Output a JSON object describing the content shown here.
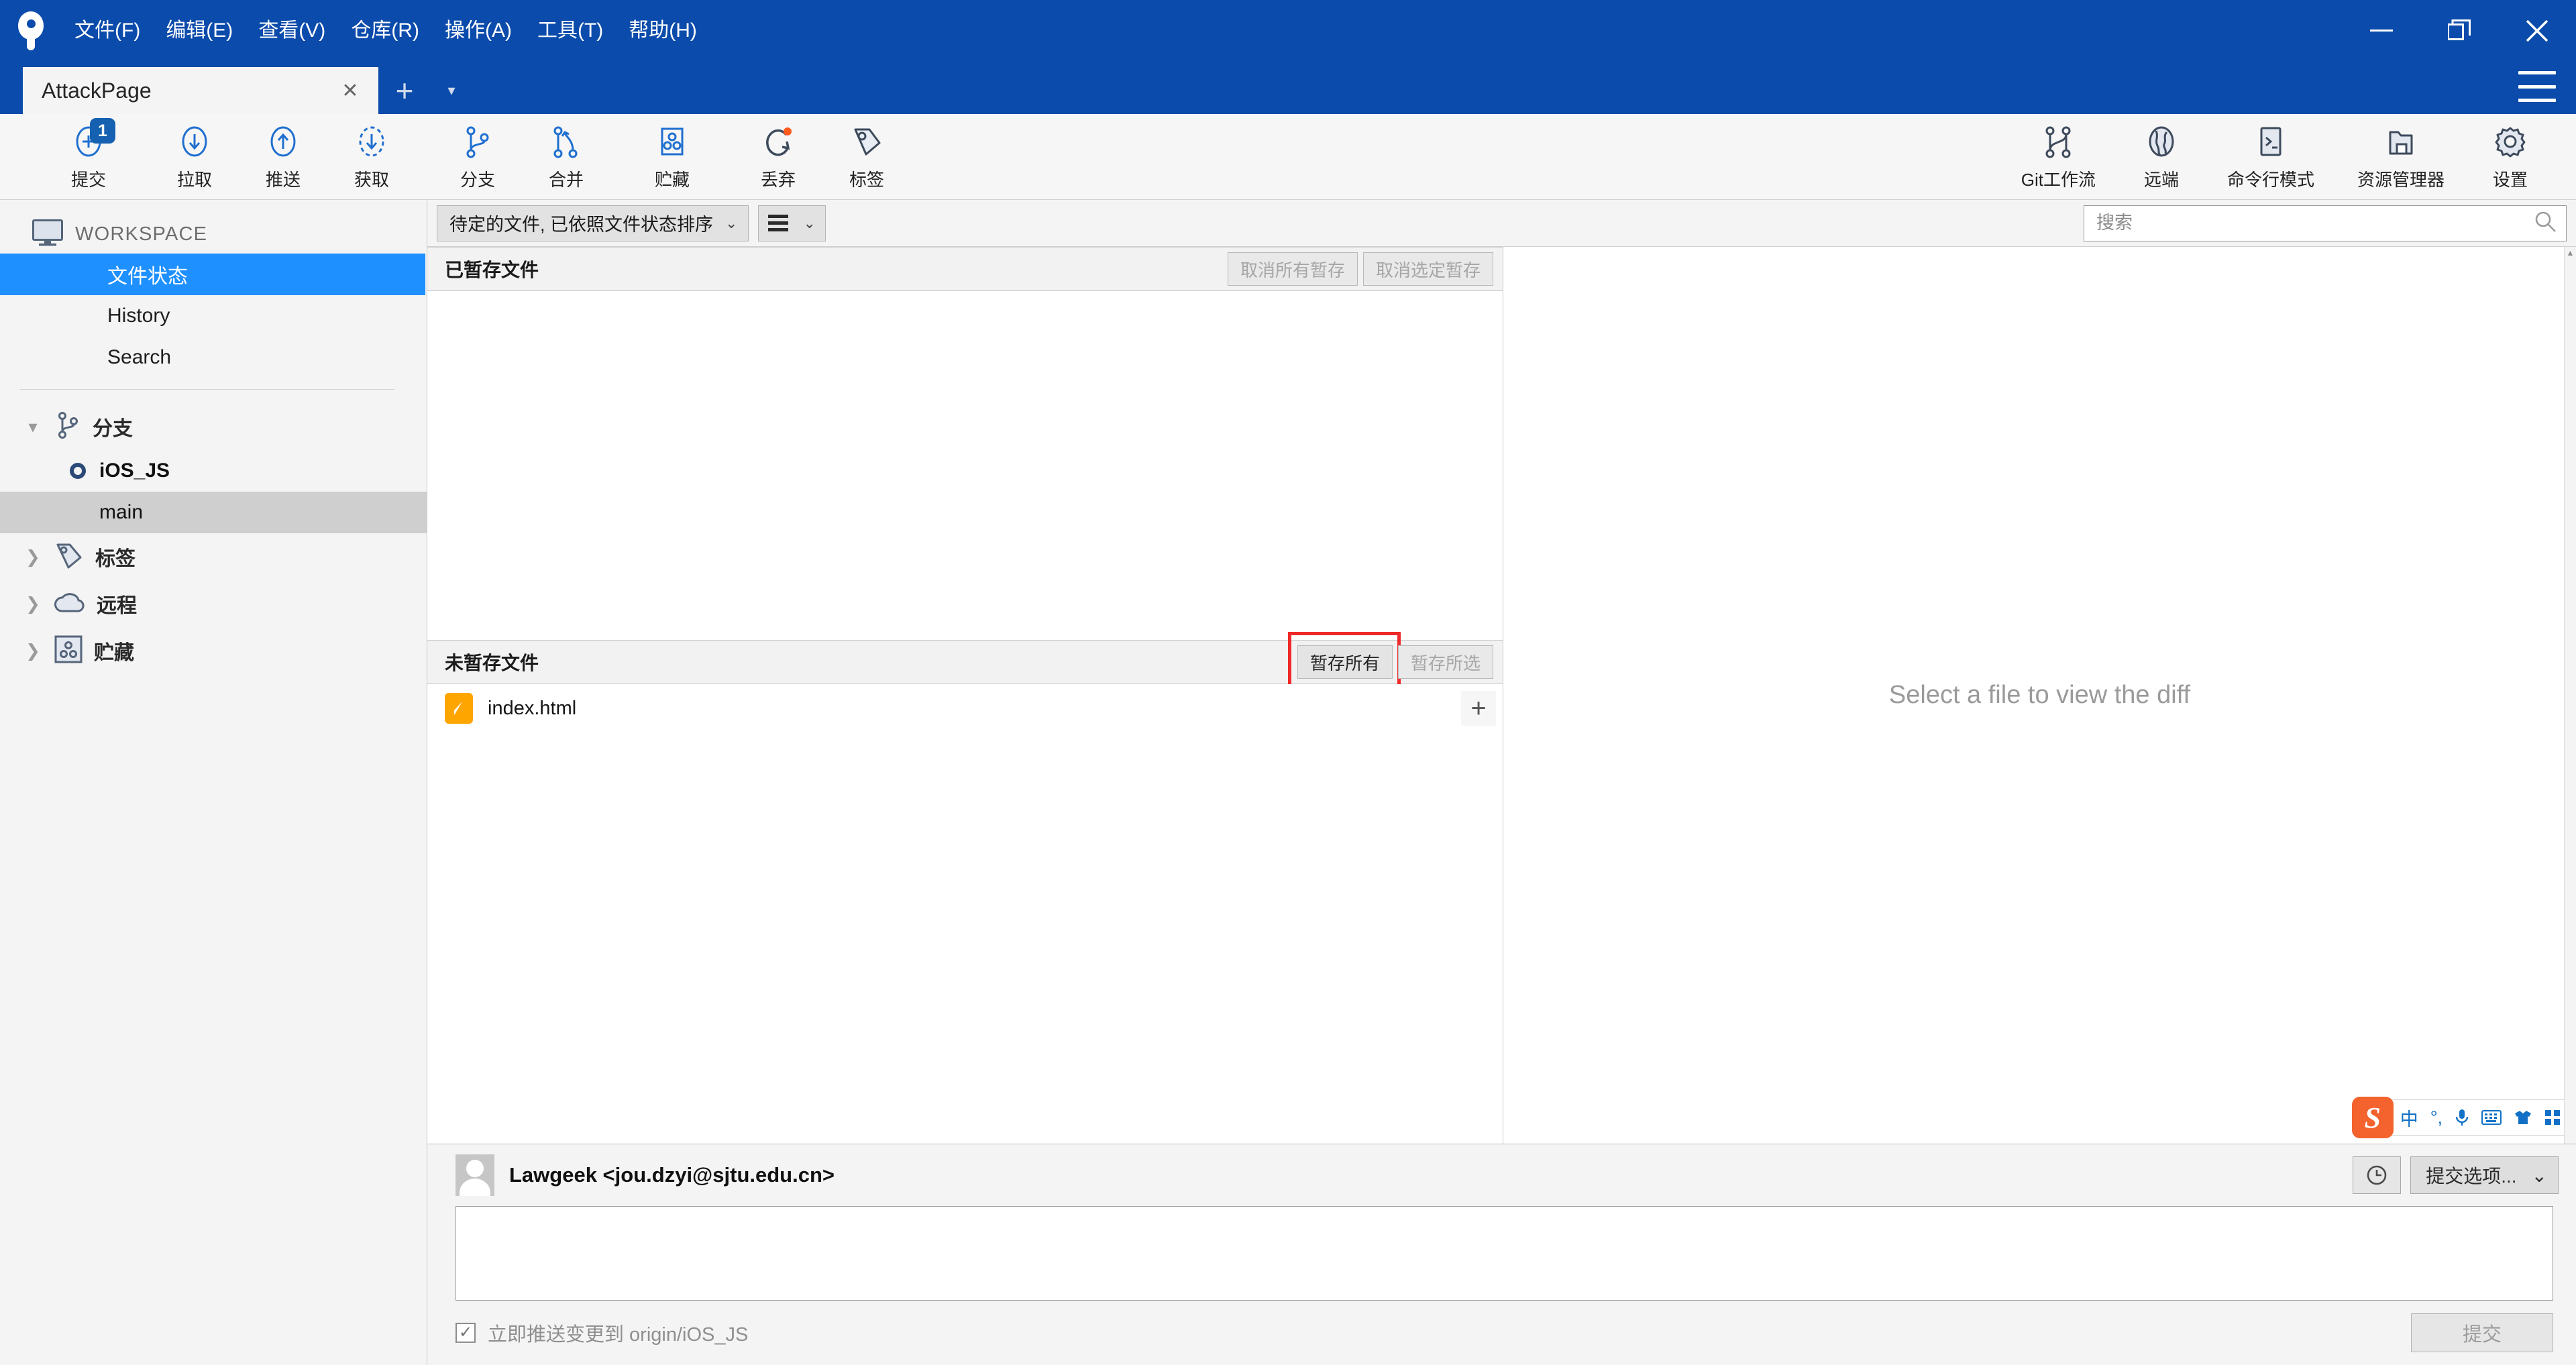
{
  "window": {
    "menus": [
      {
        "label": "文件(F)",
        "accel": "F"
      },
      {
        "label": "编辑(E)",
        "accel": "E"
      },
      {
        "label": "查看(V)",
        "accel": "V"
      },
      {
        "label": "仓库(R)",
        "accel": "R"
      },
      {
        "label": "操作(A)",
        "accel": "A"
      },
      {
        "label": "工具(T)",
        "accel": "T"
      },
      {
        "label": "帮助(H)",
        "accel": "H"
      }
    ],
    "controls": {
      "minimize": "minimize-icon",
      "restore": "restore-icon",
      "close": "close-icon"
    },
    "accent": "#0a4bab"
  },
  "tabs": {
    "active": "AttackPage",
    "close_label": "✕",
    "new_tab_label": "+",
    "tab_menu_label": "▾",
    "hamburger": "menu-icon"
  },
  "toolbar": {
    "left": [
      {
        "label": "提交",
        "icon": "commit-plus-icon",
        "badge": "1"
      },
      {
        "label": "拉取",
        "icon": "pull-down-arrow-icon"
      },
      {
        "label": "推送",
        "icon": "push-up-arrow-icon"
      },
      {
        "label": "获取",
        "icon": "fetch-dashed-arrow-icon"
      },
      {
        "label": "分支",
        "icon": "branch-icon"
      },
      {
        "label": "合并",
        "icon": "merge-icon"
      },
      {
        "label": "贮藏",
        "icon": "stash-icon"
      },
      {
        "label": "丢弃",
        "icon": "discard-reset-icon"
      },
      {
        "label": "标签",
        "icon": "tag-icon"
      }
    ],
    "right": [
      {
        "label": "Git工作流",
        "icon": "gitflow-icon"
      },
      {
        "label": "远端",
        "icon": "globe-remote-icon"
      },
      {
        "label": "命令行模式",
        "icon": "terminal-icon"
      },
      {
        "label": "资源管理器",
        "icon": "explorer-folder-icon"
      },
      {
        "label": "设置",
        "icon": "gear-icon"
      }
    ]
  },
  "sidebar": {
    "workspace_title": "WORKSPACE",
    "workspace_icon": "monitor-icon",
    "nav": [
      {
        "label": "文件状态",
        "selected": true
      },
      {
        "label": "History",
        "selected": false
      },
      {
        "label": "Search",
        "selected": false
      }
    ],
    "groups": [
      {
        "label": "分支",
        "icon": "branch-icon",
        "expanded": true,
        "twisty": "▾",
        "branches": [
          {
            "label": "iOS_JS",
            "current": true,
            "selected": false
          },
          {
            "label": "main",
            "current": false,
            "selected": true
          }
        ]
      },
      {
        "label": "标签",
        "icon": "tag-icon",
        "expanded": false,
        "twisty": "❯",
        "branches": []
      },
      {
        "label": "远程",
        "icon": "cloud-icon",
        "expanded": false,
        "twisty": "❯",
        "branches": []
      },
      {
        "label": "贮藏",
        "icon": "stash-icon",
        "expanded": false,
        "twisty": "❯",
        "branches": []
      }
    ]
  },
  "filterbar": {
    "sort_combo": "待定的文件, 已依照文件状态排序",
    "sort_caret": "⌄",
    "view_icon": "list-lines-icon",
    "view_caret": "⌄"
  },
  "search": {
    "placeholder": "搜索",
    "value": "",
    "icon": "search-icon"
  },
  "staged": {
    "title": "已暂存文件",
    "unstage_all_label": "取消所有暂存",
    "unstage_selected_label": "取消选定暂存",
    "files": []
  },
  "unstaged": {
    "title": "未暂存文件",
    "stage_all_label": "暂存所有",
    "stage_selected_label": "暂存所选",
    "highlight_color": "#ef2929",
    "files": [
      {
        "name": "index.html",
        "status_icon": "modified-pencil-icon",
        "status_color": "#ffa500",
        "add_label": "+"
      }
    ]
  },
  "diff": {
    "placeholder": "Select a file to view the diff"
  },
  "ime": {
    "logo": "sogou-ime-logo",
    "items": [
      "中",
      "°,",
      "mic-icon",
      "keyboard-icon",
      "skin-icon",
      "apps-icon"
    ]
  },
  "commit": {
    "author": "Lawgeek <jou.dzyi@sjtu.edu.cn>",
    "avatar_icon": "avatar-icon",
    "history_icon": "clock-history-icon",
    "options_label": "提交选项...",
    "options_caret": "⌄",
    "message_value": "",
    "message_placeholder": "",
    "push_checkbox": {
      "checked": true,
      "mark": "✓",
      "label": "立即推送变更到 origin/iOS_JS"
    },
    "commit_button_label": "提交"
  }
}
